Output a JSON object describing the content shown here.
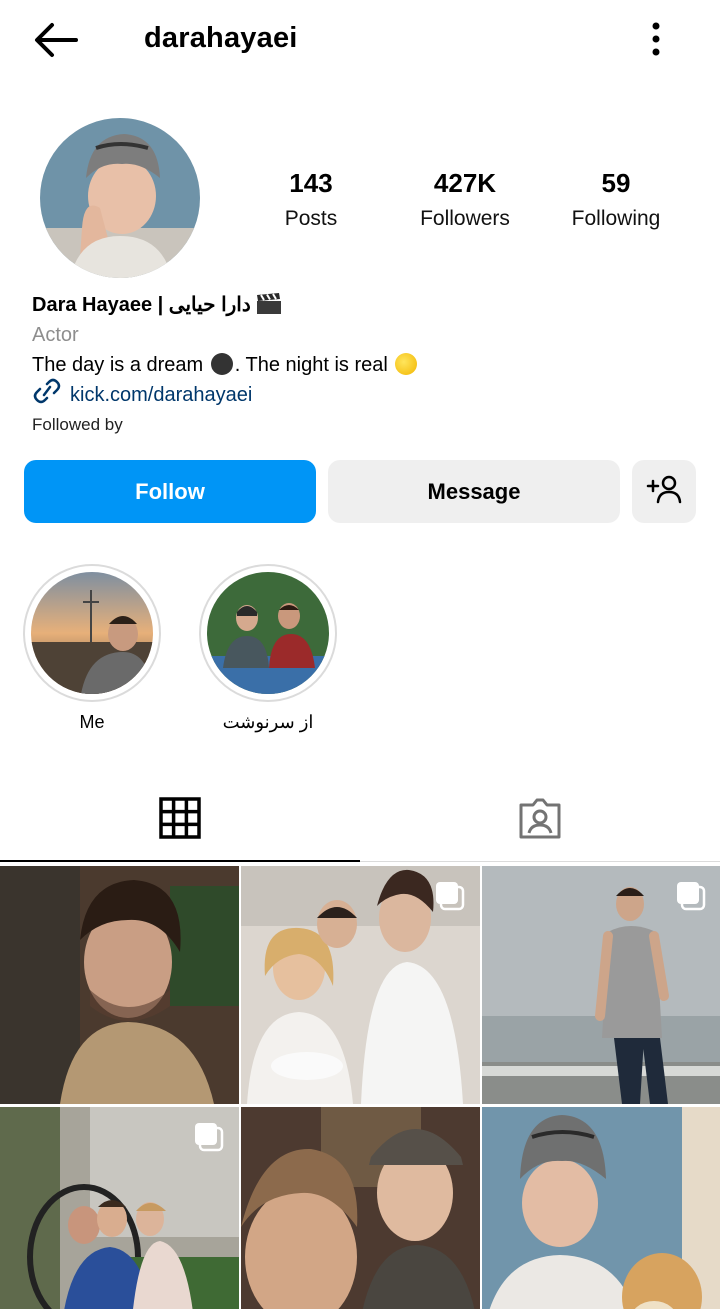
{
  "header": {
    "username": "darahayaei",
    "back_icon": "arrow-left-icon",
    "menu_icon": "more-vertical-icon"
  },
  "stats": {
    "posts": {
      "value": "143",
      "label": "Posts"
    },
    "followers": {
      "value": "427K",
      "label": "Followers"
    },
    "following": {
      "value": "59",
      "label": "Following"
    }
  },
  "bio": {
    "name": "Dara Hayaee | دارا حیایی",
    "category": "Actor",
    "text_part1": "The day is a dream ",
    "text_part2": ". The night is real ",
    "link": "kick.com/darahayaei",
    "followed_by": "Followed by"
  },
  "actions": {
    "follow": "Follow",
    "message": "Message",
    "add_user_icon": "add-person-icon"
  },
  "highlights": [
    {
      "label": "Me"
    },
    {
      "label": "از سرنوشت"
    }
  ],
  "tabs": [
    {
      "icon": "grid-icon",
      "active": true
    },
    {
      "icon": "tagged-person-icon",
      "active": false
    }
  ],
  "colors": {
    "accent": "#0095f6",
    "secondary_button": "#efefef",
    "link": "#00376b",
    "muted": "#8e8e8e"
  }
}
